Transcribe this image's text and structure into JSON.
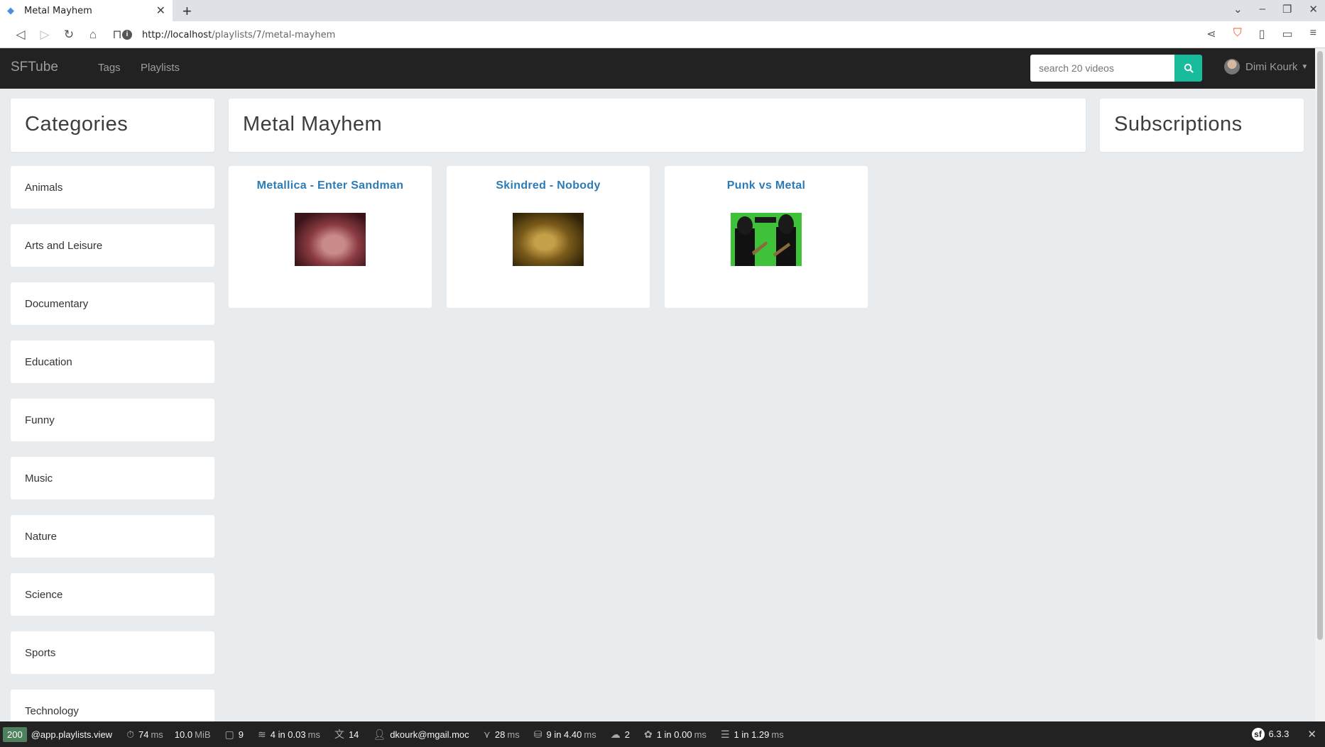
{
  "browser": {
    "tab_title": "Metal Mayhem",
    "url_host": "http://localhost",
    "url_path": "/playlists/7/metal-mayhem"
  },
  "navbar": {
    "brand": "SFTube",
    "links": [
      "Tags",
      "Playlists"
    ],
    "search_placeholder": "search 20 videos",
    "user_name": "Dimi Kourk"
  },
  "sidebar": {
    "heading": "Categories",
    "items": [
      "Animals",
      "Arts and Leisure",
      "Documentary",
      "Education",
      "Funny",
      "Music",
      "Nature",
      "Science",
      "Sports",
      "Technology"
    ]
  },
  "main": {
    "heading": "Metal Mayhem",
    "videos": [
      {
        "title": "Metallica - Enter Sandman"
      },
      {
        "title": "Skindred - Nobody"
      },
      {
        "title": "Punk vs Metal"
      }
    ]
  },
  "right": {
    "heading": "Subscriptions"
  },
  "toolbar": {
    "status": "200",
    "route": "@app.playlists.view",
    "time_value": "74",
    "time_unit": "ms",
    "memory_value": "10.0",
    "memory_unit": "MiB",
    "forms": "9",
    "cache_count": "4",
    "cache_time": "in 0.03",
    "cache_unit": "ms",
    "translations": "14",
    "user": "dkourk@mgail.moc",
    "twig_time": "28",
    "twig_unit": "ms",
    "db_count": "9",
    "db_time": "in 4.40",
    "db_unit": "ms",
    "http_count": "2",
    "events_count": "1",
    "events_time": "in 0.00",
    "events_unit": "ms",
    "messenger_count": "1",
    "messenger_time": "in 1.29",
    "messenger_unit": "ms",
    "symfony_version": "6.3.3"
  },
  "colors": {
    "navbar_bg": "#222222",
    "accent": "#18bc9c",
    "link": "#2c7bb6",
    "page_bg": "#e9ecef"
  }
}
